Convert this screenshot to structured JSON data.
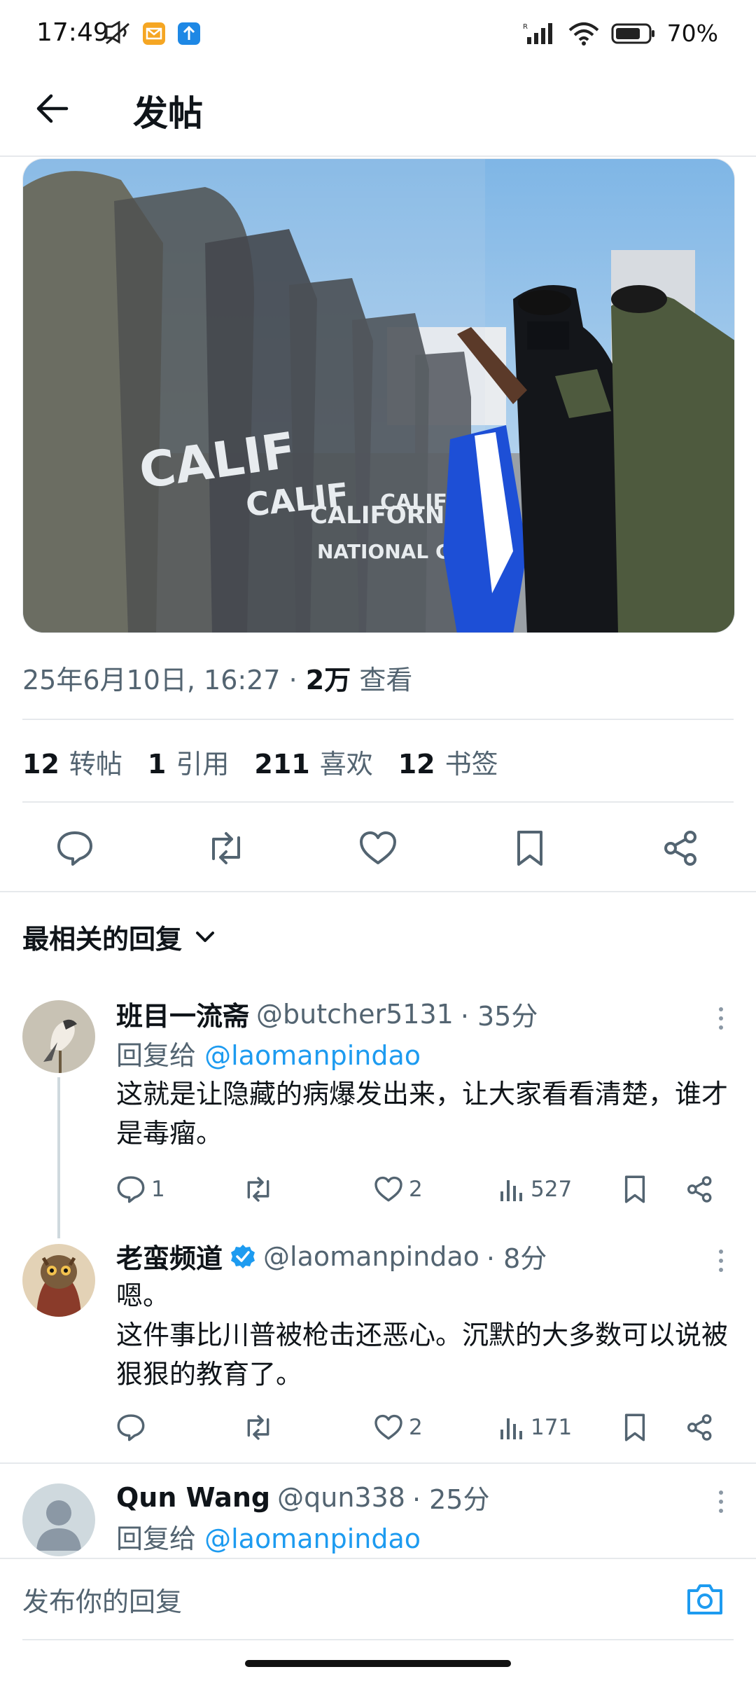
{
  "status_bar": {
    "time": "17:49",
    "battery": "70%",
    "icons": [
      "mute-icon",
      "mail-notification-icon",
      "upload-notification-icon",
      "signal-icon",
      "wifi-icon",
      "battery-icon"
    ]
  },
  "header": {
    "title": "发帖",
    "back_icon": "arrow-left-icon"
  },
  "post": {
    "timestamp": "25年6月10日, 16:27 · ",
    "views_count": "2万",
    "views_label": " 查看",
    "stats": [
      {
        "count": "12",
        "label": "转帖"
      },
      {
        "count": "1",
        "label": "引用"
      },
      {
        "count": "211",
        "label": "喜欢"
      },
      {
        "count": "12",
        "label": "书签"
      }
    ],
    "image_text": [
      "CALIF",
      "CALIF",
      "CALIFORN",
      "CALIF",
      "NATIONAL G"
    ]
  },
  "sort": {
    "label": "最相关的回复"
  },
  "replies": [
    {
      "name": "班目一流斋",
      "handle": "@butcher5131",
      "time": "· 35分",
      "reply_to_label": "回复给 ",
      "reply_to": "@laomanpindao",
      "text": "这就是让隐藏的病爆发出来，让大家看看清楚，谁才是毒瘤。",
      "replies": "1",
      "retweets": "",
      "likes": "2",
      "views": "527"
    },
    {
      "name": "老蛮频道",
      "verified": true,
      "handle": "@laomanpindao",
      "time": "· 8分",
      "text_line1": "嗯。",
      "text_rest": "这件事比川普被枪击还恶心。沉默的大多数可以说被狠狠的教育了。",
      "replies": "",
      "retweets": "",
      "likes": "2",
      "views": "171"
    },
    {
      "name": "Qun Wang",
      "handle": "@qun338",
      "time": "· 25分",
      "reply_to_label": "回复给 ",
      "reply_to": "@laomanpindao"
    }
  ],
  "reply_bar": {
    "placeholder": "发布你的回复"
  },
  "colors": {
    "accent": "#1d9bf0",
    "text": "#0f1419",
    "muted": "#536471",
    "divider": "#e6e9ec"
  }
}
